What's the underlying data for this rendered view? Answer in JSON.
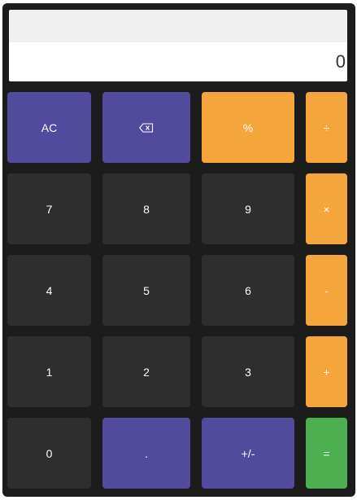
{
  "display": {
    "expression": "",
    "value": "0"
  },
  "keys": {
    "ac": "AC",
    "percent": "%",
    "divide": "÷",
    "seven": "7",
    "eight": "8",
    "nine": "9",
    "multiply": "×",
    "four": "4",
    "five": "5",
    "six": "6",
    "minus": "-",
    "one": "1",
    "two": "2",
    "three": "3",
    "plus": "+",
    "zero": "0",
    "decimal": ".",
    "negate": "+/-",
    "equals": "="
  },
  "icons": {
    "backspace": "backspace-icon"
  },
  "colors": {
    "body": "#1c1c1c",
    "function_key": "#514a9d",
    "digit_key": "#2e2e2e",
    "operator_key": "#f4a53c",
    "equals_key": "#4caf50",
    "display_bg": "#ffffff",
    "expression_bg": "#f0f0f0"
  }
}
